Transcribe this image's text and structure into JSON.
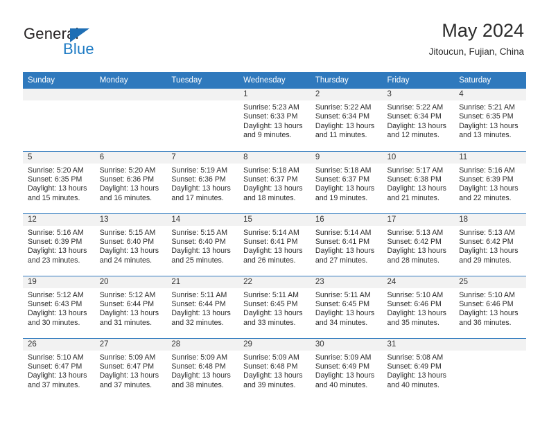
{
  "brand": {
    "name_part1": "General",
    "name_part2": "Blue",
    "accent_color": "#1e7bc4",
    "triangle_color": "#1f6fb5"
  },
  "header": {
    "title": "May 2024",
    "subtitle": "Jitoucun, Fujian, China"
  },
  "calendar": {
    "header_bg": "#2f79bd",
    "daynum_band_bg": "#f2f2f2",
    "weekday_headers": [
      "Sunday",
      "Monday",
      "Tuesday",
      "Wednesday",
      "Thursday",
      "Friday",
      "Saturday"
    ],
    "weeks": [
      [
        {
          "day": "",
          "sunrise": "",
          "sunset": "",
          "daylight": ""
        },
        {
          "day": "",
          "sunrise": "",
          "sunset": "",
          "daylight": ""
        },
        {
          "day": "",
          "sunrise": "",
          "sunset": "",
          "daylight": ""
        },
        {
          "day": "1",
          "sunrise": "Sunrise: 5:23 AM",
          "sunset": "Sunset: 6:33 PM",
          "daylight": "Daylight: 13 hours and 9 minutes."
        },
        {
          "day": "2",
          "sunrise": "Sunrise: 5:22 AM",
          "sunset": "Sunset: 6:34 PM",
          "daylight": "Daylight: 13 hours and 11 minutes."
        },
        {
          "day": "3",
          "sunrise": "Sunrise: 5:22 AM",
          "sunset": "Sunset: 6:34 PM",
          "daylight": "Daylight: 13 hours and 12 minutes."
        },
        {
          "day": "4",
          "sunrise": "Sunrise: 5:21 AM",
          "sunset": "Sunset: 6:35 PM",
          "daylight": "Daylight: 13 hours and 13 minutes."
        }
      ],
      [
        {
          "day": "5",
          "sunrise": "Sunrise: 5:20 AM",
          "sunset": "Sunset: 6:35 PM",
          "daylight": "Daylight: 13 hours and 15 minutes."
        },
        {
          "day": "6",
          "sunrise": "Sunrise: 5:20 AM",
          "sunset": "Sunset: 6:36 PM",
          "daylight": "Daylight: 13 hours and 16 minutes."
        },
        {
          "day": "7",
          "sunrise": "Sunrise: 5:19 AM",
          "sunset": "Sunset: 6:36 PM",
          "daylight": "Daylight: 13 hours and 17 minutes."
        },
        {
          "day": "8",
          "sunrise": "Sunrise: 5:18 AM",
          "sunset": "Sunset: 6:37 PM",
          "daylight": "Daylight: 13 hours and 18 minutes."
        },
        {
          "day": "9",
          "sunrise": "Sunrise: 5:18 AM",
          "sunset": "Sunset: 6:37 PM",
          "daylight": "Daylight: 13 hours and 19 minutes."
        },
        {
          "day": "10",
          "sunrise": "Sunrise: 5:17 AM",
          "sunset": "Sunset: 6:38 PM",
          "daylight": "Daylight: 13 hours and 21 minutes."
        },
        {
          "day": "11",
          "sunrise": "Sunrise: 5:16 AM",
          "sunset": "Sunset: 6:39 PM",
          "daylight": "Daylight: 13 hours and 22 minutes."
        }
      ],
      [
        {
          "day": "12",
          "sunrise": "Sunrise: 5:16 AM",
          "sunset": "Sunset: 6:39 PM",
          "daylight": "Daylight: 13 hours and 23 minutes."
        },
        {
          "day": "13",
          "sunrise": "Sunrise: 5:15 AM",
          "sunset": "Sunset: 6:40 PM",
          "daylight": "Daylight: 13 hours and 24 minutes."
        },
        {
          "day": "14",
          "sunrise": "Sunrise: 5:15 AM",
          "sunset": "Sunset: 6:40 PM",
          "daylight": "Daylight: 13 hours and 25 minutes."
        },
        {
          "day": "15",
          "sunrise": "Sunrise: 5:14 AM",
          "sunset": "Sunset: 6:41 PM",
          "daylight": "Daylight: 13 hours and 26 minutes."
        },
        {
          "day": "16",
          "sunrise": "Sunrise: 5:14 AM",
          "sunset": "Sunset: 6:41 PM",
          "daylight": "Daylight: 13 hours and 27 minutes."
        },
        {
          "day": "17",
          "sunrise": "Sunrise: 5:13 AM",
          "sunset": "Sunset: 6:42 PM",
          "daylight": "Daylight: 13 hours and 28 minutes."
        },
        {
          "day": "18",
          "sunrise": "Sunrise: 5:13 AM",
          "sunset": "Sunset: 6:42 PM",
          "daylight": "Daylight: 13 hours and 29 minutes."
        }
      ],
      [
        {
          "day": "19",
          "sunrise": "Sunrise: 5:12 AM",
          "sunset": "Sunset: 6:43 PM",
          "daylight": "Daylight: 13 hours and 30 minutes."
        },
        {
          "day": "20",
          "sunrise": "Sunrise: 5:12 AM",
          "sunset": "Sunset: 6:44 PM",
          "daylight": "Daylight: 13 hours and 31 minutes."
        },
        {
          "day": "21",
          "sunrise": "Sunrise: 5:11 AM",
          "sunset": "Sunset: 6:44 PM",
          "daylight": "Daylight: 13 hours and 32 minutes."
        },
        {
          "day": "22",
          "sunrise": "Sunrise: 5:11 AM",
          "sunset": "Sunset: 6:45 PM",
          "daylight": "Daylight: 13 hours and 33 minutes."
        },
        {
          "day": "23",
          "sunrise": "Sunrise: 5:11 AM",
          "sunset": "Sunset: 6:45 PM",
          "daylight": "Daylight: 13 hours and 34 minutes."
        },
        {
          "day": "24",
          "sunrise": "Sunrise: 5:10 AM",
          "sunset": "Sunset: 6:46 PM",
          "daylight": "Daylight: 13 hours and 35 minutes."
        },
        {
          "day": "25",
          "sunrise": "Sunrise: 5:10 AM",
          "sunset": "Sunset: 6:46 PM",
          "daylight": "Daylight: 13 hours and 36 minutes."
        }
      ],
      [
        {
          "day": "26",
          "sunrise": "Sunrise: 5:10 AM",
          "sunset": "Sunset: 6:47 PM",
          "daylight": "Daylight: 13 hours and 37 minutes."
        },
        {
          "day": "27",
          "sunrise": "Sunrise: 5:09 AM",
          "sunset": "Sunset: 6:47 PM",
          "daylight": "Daylight: 13 hours and 37 minutes."
        },
        {
          "day": "28",
          "sunrise": "Sunrise: 5:09 AM",
          "sunset": "Sunset: 6:48 PM",
          "daylight": "Daylight: 13 hours and 38 minutes."
        },
        {
          "day": "29",
          "sunrise": "Sunrise: 5:09 AM",
          "sunset": "Sunset: 6:48 PM",
          "daylight": "Daylight: 13 hours and 39 minutes."
        },
        {
          "day": "30",
          "sunrise": "Sunrise: 5:09 AM",
          "sunset": "Sunset: 6:49 PM",
          "daylight": "Daylight: 13 hours and 40 minutes."
        },
        {
          "day": "31",
          "sunrise": "Sunrise: 5:08 AM",
          "sunset": "Sunset: 6:49 PM",
          "daylight": "Daylight: 13 hours and 40 minutes."
        },
        {
          "day": "",
          "sunrise": "",
          "sunset": "",
          "daylight": ""
        }
      ]
    ]
  }
}
